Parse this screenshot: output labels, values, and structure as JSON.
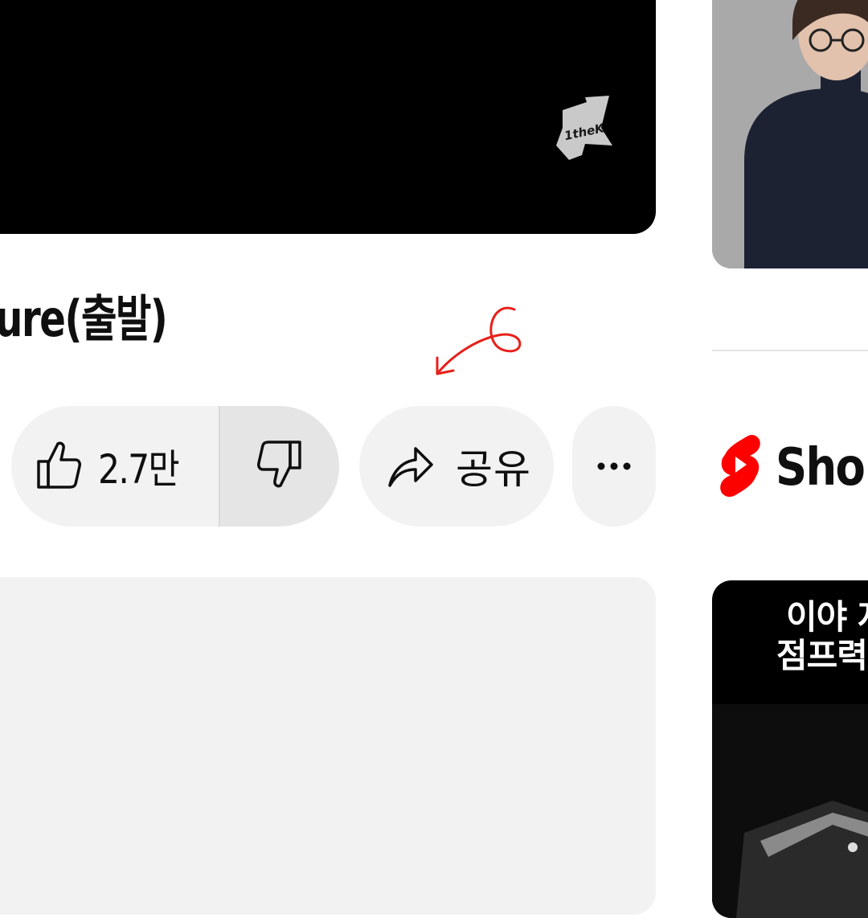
{
  "video": {
    "title": "ure(출발)",
    "watermark_text": "1theK"
  },
  "actions": {
    "like_count": "2.7만",
    "share_label": "공유",
    "more_label": "···"
  },
  "annotation": {
    "number": "6",
    "color": "#e8201a"
  },
  "sidebar": {
    "shorts_label": "Sho",
    "short_caption_lines": [
      "이야 저",
      "점프력"
    ]
  },
  "colors": {
    "shorts_red": "#ff0000",
    "pill_bg": "#f2f2f2",
    "dislike_bg": "#e5e5e5",
    "text": "#0f0f0f"
  }
}
